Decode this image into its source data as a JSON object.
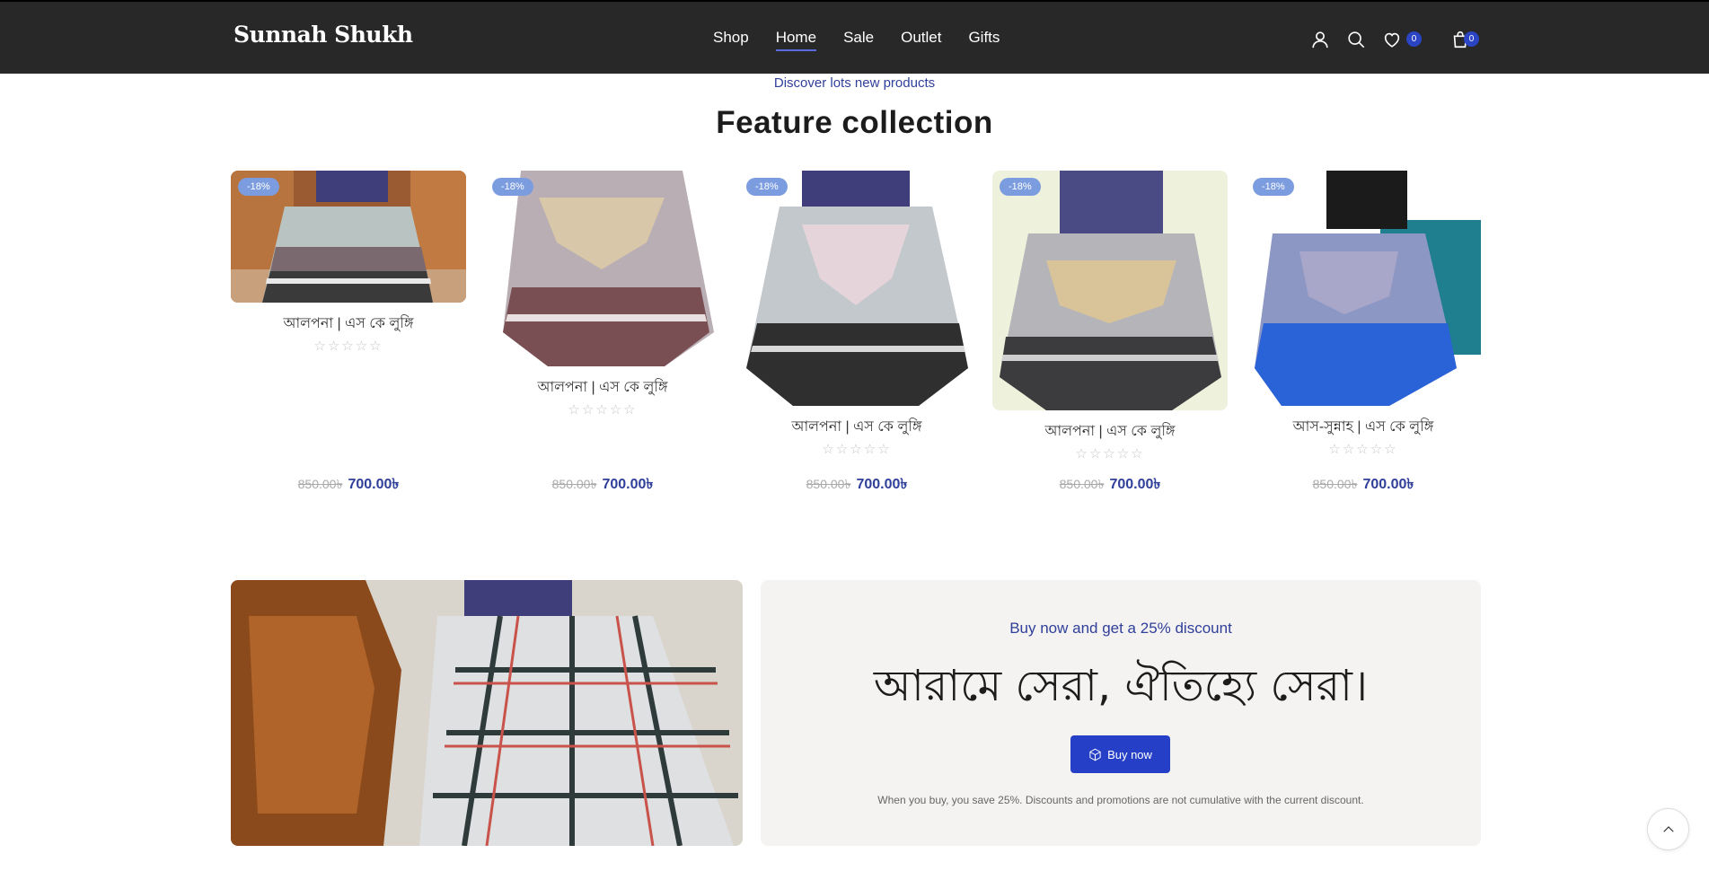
{
  "header": {
    "logo": "Sunnah Shukh",
    "nav": [
      "Shop",
      "Home",
      "Sale",
      "Outlet",
      "Gifts"
    ],
    "active_nav": "Home",
    "wishlist_count": "0",
    "cart_count": "0"
  },
  "feature": {
    "subheading": "Discover lots new products",
    "title": "Feature collection"
  },
  "products": [
    {
      "badge": "-18%",
      "name": "আলপনা | এস কে লুঙ্গি",
      "old_price": "850.00৳",
      "price": "700.00৳",
      "rating": 0
    },
    {
      "badge": "-18%",
      "name": "আলপনা | এস কে লুঙ্গি",
      "old_price": "850.00৳",
      "price": "700.00৳",
      "rating": 0
    },
    {
      "badge": "-18%",
      "name": "আলপনা | এস কে লুঙ্গি",
      "old_price": "850.00৳",
      "price": "700.00৳",
      "rating": 0
    },
    {
      "badge": "-18%",
      "name": "আলপনা | এস কে লুঙ্গি",
      "old_price": "850.00৳",
      "price": "700.00৳",
      "rating": 0
    },
    {
      "badge": "-18%",
      "name": "আস-সুন্নাহ | এস কে লুঙ্গি",
      "old_price": "850.00৳",
      "price": "700.00৳",
      "rating": 0
    }
  ],
  "banner": {
    "tagline": "Buy now and get a 25% discount",
    "headline": "আরামে সেরা, ঐতিহ্যে সেরা।",
    "button": "Buy now",
    "note": "When you buy, you save 25%. Discounts and promotions are not cumulative with the current discount."
  },
  "colors": {
    "header_bg": "#282828",
    "accent": "#2540c6",
    "price": "#2f3f9a",
    "badge": "#7c9ce0",
    "panel_bg": "#f5f3f1"
  },
  "icons": [
    "user-icon",
    "search-icon",
    "heart-icon",
    "bag-icon",
    "cube-icon",
    "chevron-up-icon"
  ]
}
